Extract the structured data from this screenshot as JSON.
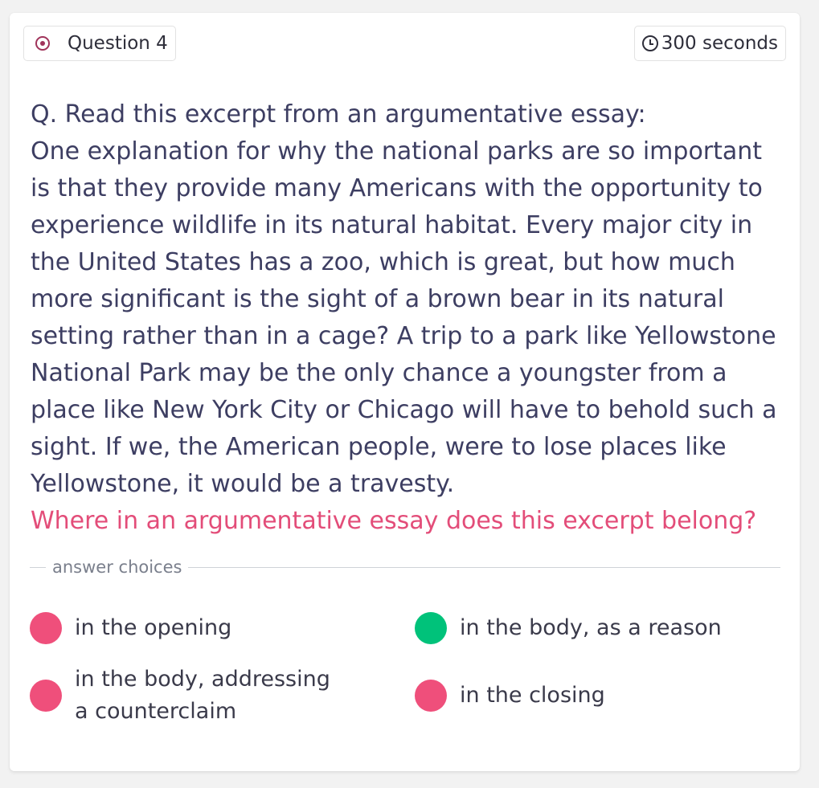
{
  "header": {
    "question_label": "Question 4",
    "timer_label": "300 seconds"
  },
  "question": {
    "intro": "Q. Read this excerpt from an argumentative essay:",
    "excerpt": "One explanation for why the national parks are so important is that they provide many Americans with the opportunity to experience wildlife in its natural habitat. Every major city in the United States has a zoo, which is great, but how much more significant is the sight of a brown bear in its natural setting rather than in a cage? A trip to a park like Yellowstone National Park may be the only chance a youngster from a place like New York City or Chicago will have to behold such a sight. If we, the American people, were to lose places like Yellowstone, it would be a travesty.",
    "prompt": "Where in an argumentative essay does this excerpt belong?"
  },
  "divider": {
    "label": "answer choices"
  },
  "choices": [
    {
      "text": "in the opening",
      "status": "incorrect",
      "color": "#ef4f7b"
    },
    {
      "text": "in the body, as a reason",
      "status": "correct",
      "color": "#00c27a"
    },
    {
      "text": "in the body, addressing a counterclaim",
      "status": "incorrect",
      "color": "#ef4f7b"
    },
    {
      "text": "in the closing",
      "status": "incorrect",
      "color": "#ef4f7b"
    }
  ],
  "icons": {
    "question": "target-icon",
    "timer": "clock-icon"
  }
}
